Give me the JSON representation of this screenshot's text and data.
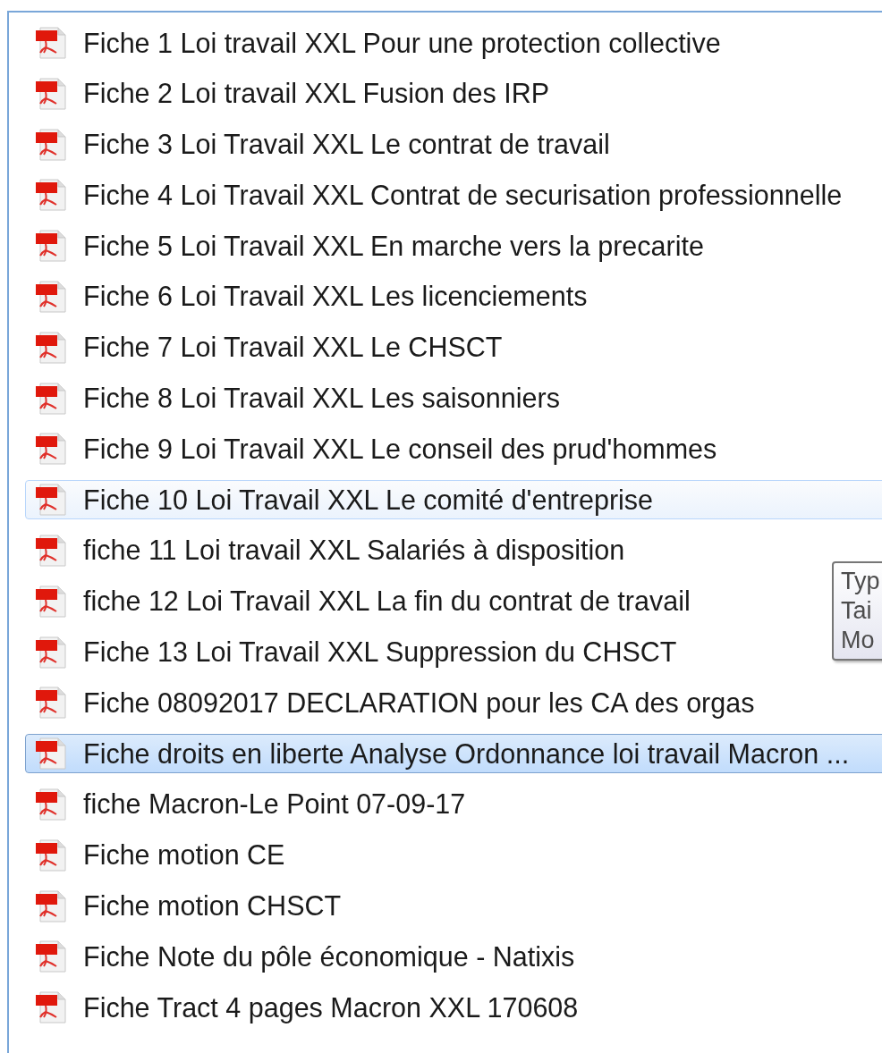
{
  "files": [
    {
      "name": "Fiche 1 Loi travail XXL Pour une protection collective",
      "selected": false,
      "hovered": false
    },
    {
      "name": "Fiche 2 Loi travail XXL Fusion des IRP",
      "selected": false,
      "hovered": false
    },
    {
      "name": "Fiche 3 Loi Travail XXL Le contrat de travail",
      "selected": false,
      "hovered": false
    },
    {
      "name": "Fiche 4 Loi Travail XXL Contrat de securisation professionnelle",
      "selected": false,
      "hovered": false
    },
    {
      "name": "Fiche 5 Loi Travail XXL En marche vers la precarite",
      "selected": false,
      "hovered": false
    },
    {
      "name": "Fiche 6 Loi Travail XXL Les licenciements",
      "selected": false,
      "hovered": false
    },
    {
      "name": "Fiche 7 Loi Travail XXL Le CHSCT",
      "selected": false,
      "hovered": false
    },
    {
      "name": "Fiche 8 Loi Travail XXL Les saisonniers",
      "selected": false,
      "hovered": false
    },
    {
      "name": "Fiche 9 Loi Travail XXL Le conseil des prud'hommes",
      "selected": false,
      "hovered": false
    },
    {
      "name": "Fiche 10 Loi Travail XXL Le comité d'entreprise",
      "selected": false,
      "hovered": true
    },
    {
      "name": "fiche 11 Loi travail XXL Salariés à disposition",
      "selected": false,
      "hovered": false
    },
    {
      "name": "fiche 12 Loi Travail XXL La fin du contrat de travail",
      "selected": false,
      "hovered": false
    },
    {
      "name": "Fiche 13 Loi Travail XXL Suppression du CHSCT",
      "selected": false,
      "hovered": false
    },
    {
      "name": "Fiche 08092017 DECLARATION pour les CA des orgas",
      "selected": false,
      "hovered": false
    },
    {
      "name": "Fiche droits en liberte Analyse Ordonnance loi travail Macron ...",
      "selected": true,
      "hovered": false
    },
    {
      "name": "fiche Macron-Le Point 07-09-17",
      "selected": false,
      "hovered": false
    },
    {
      "name": "Fiche motion CE",
      "selected": false,
      "hovered": false
    },
    {
      "name": "Fiche motion CHSCT",
      "selected": false,
      "hovered": false
    },
    {
      "name": "Fiche Note du pôle économique - Natixis",
      "selected": false,
      "hovered": false
    },
    {
      "name": "Fiche Tract 4 pages Macron XXL 170608",
      "selected": false,
      "hovered": false
    }
  ],
  "tooltip": {
    "lines": [
      "Typ",
      "Tai",
      "Mo"
    ]
  }
}
